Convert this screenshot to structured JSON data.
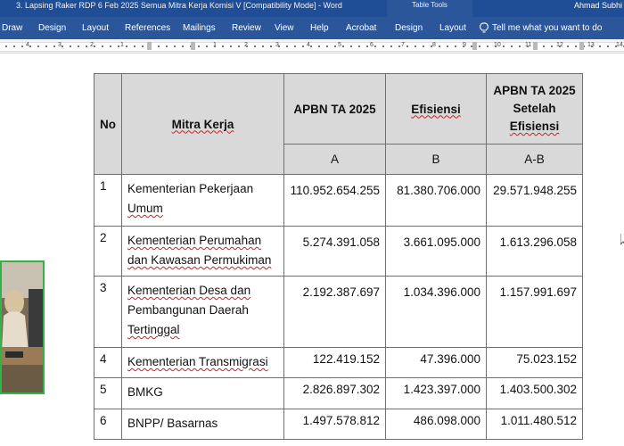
{
  "window": {
    "title": "3. Lapsing Raker RDP 6 Feb 2025 Semua Mitra Kerja Komisi V [Compatibility Mode]  -  Word",
    "user": "Ahmad Subhi",
    "context_group": "Table Tools"
  },
  "ribbon": {
    "tabs": [
      "Draw",
      "Design",
      "Layout",
      "References",
      "Mailings",
      "Review",
      "View",
      "Help",
      "Acrobat"
    ],
    "context_tabs": [
      "Design",
      "Layout"
    ],
    "tell_me": "Tell me what you want to do"
  },
  "ruler": {
    "numbers": [
      "4",
      "3",
      "2",
      "1",
      "1",
      "2",
      "3",
      "4",
      "5",
      "6",
      "7",
      "8",
      "9",
      "10",
      "11",
      "12",
      "13",
      "14"
    ]
  },
  "table": {
    "headers": {
      "no": "No",
      "mitra": "Mitra Kerja",
      "apbn": "APBN TA 2025",
      "efisiensi": "Efisiensi",
      "setelah": [
        "APBN TA 2025",
        "Setelah",
        "Efisiensi"
      ]
    },
    "sub_headers": [
      "A",
      "B",
      "A-B"
    ],
    "rows": [
      {
        "no": "1",
        "mitra": [
          "Kementerian Pekerjaan",
          "Umum"
        ],
        "apbn": "110.952.654.255",
        "efisiensi": "81.380.706.000",
        "setelah": "29.571.948.255"
      },
      {
        "no": "2",
        "mitra": [
          "Kementerian Perumahan",
          "dan Kawasan Permukiman"
        ],
        "apbn": "5.274.391.058",
        "efisiensi": "3.661.095.000",
        "setelah": "1.613.296.058"
      },
      {
        "no": "3",
        "mitra": [
          "Kementerian Desa dan",
          "Pembangunan Daerah",
          "Tertinggal"
        ],
        "apbn": "2.192.387.697",
        "efisiensi": "1.034.396.000",
        "setelah": "1.157.991.697"
      },
      {
        "no": "4",
        "mitra": [
          "Kementerian Transmigrasi"
        ],
        "apbn": "122.419.152",
        "efisiensi": "47.396.000",
        "setelah": "75.023.152"
      },
      {
        "no": "5",
        "mitra": [
          "BMKG"
        ],
        "apbn": "2.826.897.302",
        "efisiensi": "1.423.397.000",
        "setelah": "1.403.500.302"
      },
      {
        "no": "6",
        "mitra": [
          "BNPP/ Basarnas"
        ],
        "apbn": "1.497.578.812",
        "efisiensi": "486.098.000",
        "setelah": "1.011.480.512"
      }
    ]
  },
  "colors": {
    "titlebar": "#1f4e96",
    "ribbon": "#2b579a",
    "header_fill": "#d9d9d9",
    "video_border": "#33b24a"
  }
}
